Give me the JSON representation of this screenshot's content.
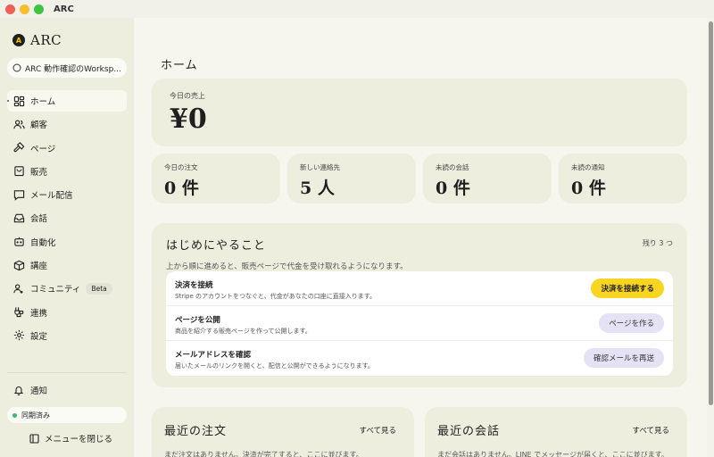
{
  "window": {
    "title": "ARC"
  },
  "sidebar": {
    "brand": {
      "logo_letter": "A",
      "name": "ARC"
    },
    "workspace": "ARC 動作確認のWorksp...",
    "items": [
      {
        "label": "ホーム",
        "icon": "grid-icon",
        "active": true
      },
      {
        "label": "顧客",
        "icon": "users-icon"
      },
      {
        "label": "ページ",
        "icon": "hammer-icon"
      },
      {
        "label": "販売",
        "icon": "shopping-bag-icon"
      },
      {
        "label": "メール配信",
        "icon": "message-icon"
      },
      {
        "label": "会話",
        "icon": "inbox-icon"
      },
      {
        "label": "自動化",
        "icon": "bot-icon"
      },
      {
        "label": "講座",
        "icon": "box-icon"
      },
      {
        "label": "コミュニティ",
        "icon": "community-icon",
        "badge": "Beta"
      },
      {
        "label": "連携",
        "icon": "integration-icon"
      },
      {
        "label": "設定",
        "icon": "gear-icon"
      }
    ],
    "notifications_label": "通知",
    "sync_status": "同期済み",
    "sync_color": "#3bb86a",
    "close_menu_label": "メニューを閉じる"
  },
  "main": {
    "page_title": "ホーム",
    "sales": {
      "label": "今日の売上",
      "value": "¥0"
    },
    "stats": [
      {
        "label": "今日の注文",
        "value": "0 件"
      },
      {
        "label": "新しい連絡先",
        "value": "5 人"
      },
      {
        "label": "未読の会話",
        "value": "0 件"
      },
      {
        "label": "未読の通知",
        "value": "0 件"
      }
    ],
    "todo": {
      "title": "はじめにやること",
      "remaining": "残り 3 つ",
      "description": "上から順に進めると、販売ページで代金を受け取れるようになります。",
      "rows": [
        {
          "title": "決済を接続",
          "desc": "Stripe のアカウントをつなぐと、代金があなたの口座に直接入ります。",
          "button": "決済を接続する"
        },
        {
          "title": "ページを公開",
          "desc": "商品を紹介する販売ページを作って公開します。",
          "button": "ページを作る"
        },
        {
          "title": "メールアドレスを確認",
          "desc": "届いたメールのリンクを開くと、配信と公開ができるようになります。",
          "button": "確認メールを再送"
        }
      ]
    },
    "recent_orders": {
      "title": "最近の注文",
      "link": "すべて見る",
      "empty": "まだ注文はありません。決済が完了すると、ここに並びます。"
    },
    "recent_conversations": {
      "title": "最近の会話",
      "link": "すべて見る",
      "empty": "まだ会話はありません。LINE でメッセージが届くと、ここに並びます。"
    }
  },
  "colors": {
    "accent_yellow": "#f7d520",
    "lavender": "#e6e2f6",
    "card_bg": "#eeeedf",
    "page_bg": "#f6f6ee"
  }
}
